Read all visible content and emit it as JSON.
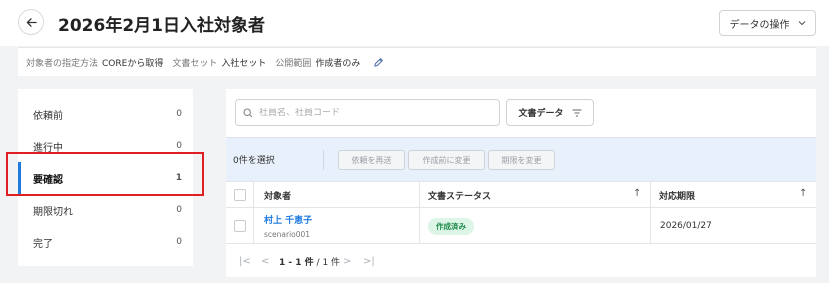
{
  "header": {
    "title": "2026年2月1日入社対象者",
    "data_op_label": "データの操作"
  },
  "meta": {
    "method_label": "対象者の指定方法",
    "method_value": "COREから取得",
    "docset_label": "文書セット",
    "docset_value": "入社セット",
    "scope_label": "公開範囲",
    "scope_value": "作成者のみ"
  },
  "sidebar": {
    "items": [
      {
        "label": "依頼前",
        "count": "0"
      },
      {
        "label": "進行中",
        "count": "0"
      },
      {
        "label": "要確認",
        "count": "1"
      },
      {
        "label": "期限切れ",
        "count": "0"
      },
      {
        "label": "完了",
        "count": "0"
      }
    ]
  },
  "search": {
    "placeholder": "社員名、社員コード"
  },
  "filter": {
    "doc_data_label": "文書データ"
  },
  "bulk": {
    "selected": "0件を選択",
    "resend": "依頼を再送",
    "revert": "作成前に変更",
    "deadline": "期限を変更"
  },
  "table": {
    "headers": {
      "target": "対象者",
      "status": "文書ステータス",
      "deadline": "対応期限"
    },
    "rows": [
      {
        "name": "村上 千恵子",
        "code": "scenario001",
        "status": "作成済み",
        "deadline": "2026/01/27"
      }
    ]
  },
  "pager": {
    "range": "1 - 1 件",
    "sep": " / ",
    "total": "1 件"
  },
  "colors": {
    "accent": "#1f7ae0",
    "highlight": "#e02020",
    "badge_bg": "#dcf5e6",
    "badge_text": "#1e8a4a"
  }
}
